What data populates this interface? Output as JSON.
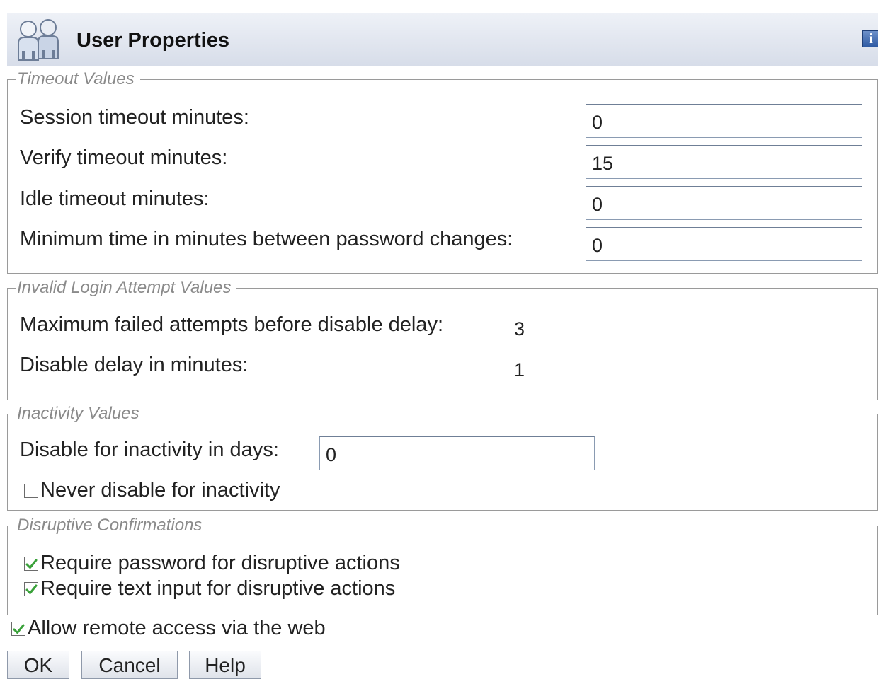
{
  "title": "User Properties",
  "info_icon": "info-icon",
  "timeout": {
    "legend": "Timeout Values",
    "session_label": "Session timeout minutes:",
    "session_value": "0",
    "verify_label": "Verify timeout minutes:",
    "verify_value": "15",
    "idle_label": "Idle timeout minutes:",
    "idle_value": "0",
    "min_pw_label": "Minimum time in minutes between password changes:",
    "min_pw_value": "0"
  },
  "invalid_login": {
    "legend": "Invalid Login Attempt Values",
    "max_failed_label": "Maximum failed attempts before disable delay:",
    "max_failed_value": "3",
    "disable_delay_label": "Disable delay in minutes:",
    "disable_delay_value": "1"
  },
  "inactivity": {
    "legend": "Inactivity Values",
    "disable_days_label": "Disable for inactivity in days:",
    "disable_days_value": "0",
    "never_disable_label": "Never disable for inactivity",
    "never_disable_checked": false
  },
  "disruptive": {
    "legend": "Disruptive Confirmations",
    "require_password_label": "Require password for disruptive actions",
    "require_password_checked": true,
    "require_text_label": "Require text input for disruptive actions",
    "require_text_checked": true
  },
  "remote_access": {
    "label": "Allow remote access via the web",
    "checked": true
  },
  "buttons": {
    "ok": "OK",
    "cancel": "Cancel",
    "help": "Help"
  },
  "colors": {
    "checkmark": "#3aa13a",
    "title_bar_top": "#eef1f7",
    "title_bar_bottom": "#d7dde9",
    "legend_text": "#8a8a8a"
  }
}
